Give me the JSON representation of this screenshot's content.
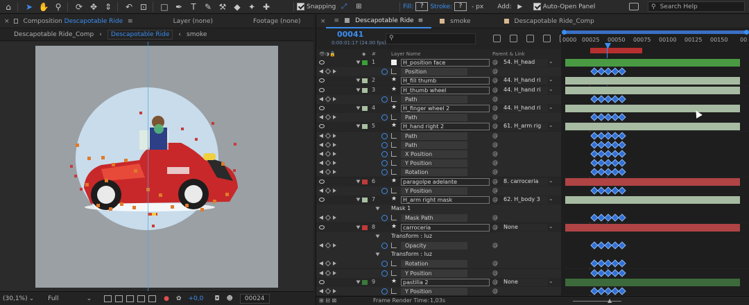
{
  "toolbar": {
    "snapping_label": "Snapping",
    "fill_label": "Fill:",
    "fill_value": "?",
    "stroke_label": "Stroke:",
    "stroke_value": "?",
    "stroke_unit": "- px",
    "add_label": "Add:",
    "auto_open_label": "Auto-Open Panel",
    "search_placeholder": "Search Help"
  },
  "composition_panel": {
    "tabs": [
      {
        "prefix": "Composition",
        "name": "Descapotable Ride",
        "label": "Composition Descapotable Ride"
      },
      {
        "label": "Layer (none)"
      },
      {
        "label": "Footage (none)"
      }
    ],
    "breadcrumbs": [
      "Descapotable Ride_Comp",
      "Descapotable Ride",
      "smoke"
    ],
    "footer": {
      "zoom": "(30,1%)",
      "resolution": "Full",
      "exposure": "+0,0",
      "frame": "00024"
    }
  },
  "timeline": {
    "tabs": [
      {
        "label": "Descapotable Ride",
        "color": "#a0a0a0"
      },
      {
        "label": "smoke",
        "color": "#d8b890"
      },
      {
        "label": "Descapotable Ride_Comp",
        "color": "#d8b890"
      }
    ],
    "current_time": "00041",
    "current_time_sub": "0:00:01:17 (24.00 fps)",
    "ruler_ticks": [
      "0000",
      "00025",
      "00050",
      "00075",
      "00100",
      "00125",
      "00150",
      "00"
    ],
    "headers": {
      "num": "#",
      "layer_name": "Layer Name",
      "parent": "Parent & Link"
    },
    "rows": [
      {
        "kind": "layer",
        "num": "1",
        "name": "H_position face",
        "color": "#3aa03a",
        "parent": "54. H_head",
        "bar": "#4a9a44"
      },
      {
        "kind": "prop",
        "name": "Position"
      },
      {
        "kind": "layer",
        "num": "2",
        "name": "H_fill thumb",
        "color": "#a8bfa0",
        "parent": "44. H_hand ri",
        "bar": "#a7bba2"
      },
      {
        "kind": "layer",
        "num": "3",
        "name": "H_thumb wheel",
        "color": "#a8bfa0",
        "parent": "44. H_hand ri",
        "bar": "#a7bba2"
      },
      {
        "kind": "prop",
        "name": "Path"
      },
      {
        "kind": "layer",
        "num": "4",
        "name": "H_finger wheel 2",
        "color": "#a8bfa0",
        "parent": "44. H_hand ri",
        "bar": "#a7bba2"
      },
      {
        "kind": "prop",
        "name": "Path"
      },
      {
        "kind": "layer",
        "num": "5",
        "name": "H_hand right 2",
        "color": "#a8bfa0",
        "parent": "61. H_arm rig",
        "bar": "#a7bba2"
      },
      {
        "kind": "prop",
        "name": "Path"
      },
      {
        "kind": "prop",
        "name": "Path"
      },
      {
        "kind": "prop",
        "name": "X Position"
      },
      {
        "kind": "prop",
        "name": "Y Position"
      },
      {
        "kind": "prop",
        "name": "Rotation"
      },
      {
        "kind": "layer",
        "num": "6",
        "name": "paragolpe adelante",
        "color": "#c03a3a",
        "parent": "8. carroceria",
        "bar": "#b04444"
      },
      {
        "kind": "prop",
        "name": "Y Position"
      },
      {
        "kind": "layer",
        "num": "7",
        "name": "H_arm right mask",
        "color": "#a8bfa0",
        "parent": "62. H_body 3",
        "bar": "#a7bba2"
      },
      {
        "kind": "group",
        "name": "Mask 1"
      },
      {
        "kind": "prop",
        "name": "Mask Path"
      },
      {
        "kind": "layer",
        "num": "8",
        "name": "carroceria",
        "color": "#c03a3a",
        "parent": "None",
        "bar": "#b04444"
      },
      {
        "kind": "group",
        "name": "Transform : luz"
      },
      {
        "kind": "prop",
        "name": "Opacity"
      },
      {
        "kind": "group",
        "name": "Transform : luz"
      },
      {
        "kind": "prop",
        "name": "Rotation"
      },
      {
        "kind": "prop",
        "name": "Y Position"
      },
      {
        "kind": "layer",
        "num": "9",
        "name": "pastilla 2",
        "color": "#3a7a3a",
        "parent": "None",
        "bar": "#3c6a3a"
      },
      {
        "kind": "prop",
        "name": "Y Position"
      }
    ],
    "frame_render_label": "Frame Render Time:",
    "frame_render_value": "1,03s"
  }
}
